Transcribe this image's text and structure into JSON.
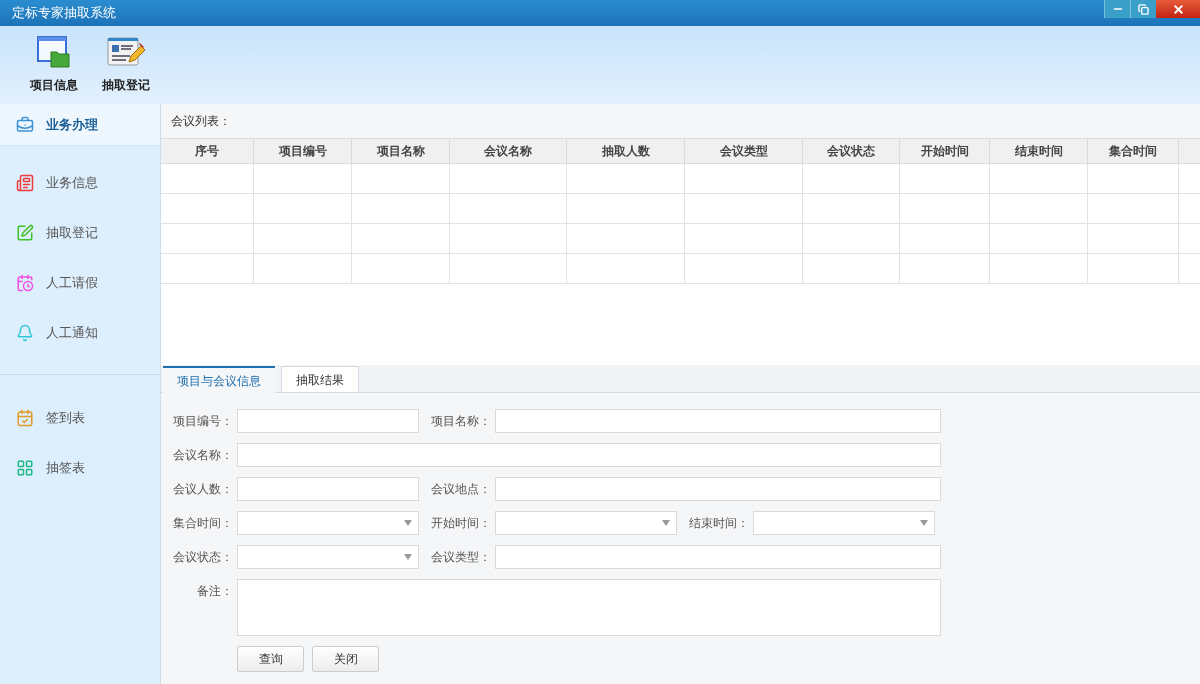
{
  "window": {
    "title": "定标专家抽取系统"
  },
  "toolbar": [
    {
      "label": "项目信息"
    },
    {
      "label": "抽取登记"
    }
  ],
  "sidebar": {
    "sections": [
      {
        "items": [
          {
            "label": "业务办理",
            "selected": true
          },
          {
            "label": "业务信息",
            "selected": false
          },
          {
            "label": "抽取登记",
            "selected": false
          },
          {
            "label": "人工请假",
            "selected": false
          },
          {
            "label": "人工通知",
            "selected": false
          }
        ]
      },
      {
        "items": [
          {
            "label": "签到表",
            "selected": false
          },
          {
            "label": "抽签表",
            "selected": false
          }
        ]
      }
    ]
  },
  "table": {
    "title": "会议列表：",
    "columns": [
      "序号",
      "项目编号",
      "项目名称",
      "会议名称",
      "抽取人数",
      "会议类型",
      "会议状态",
      "开始时间",
      "结束时间",
      "集合时间"
    ]
  },
  "tabs": [
    {
      "label": "项目与会议信息",
      "selected": true
    },
    {
      "label": "抽取结果",
      "selected": false
    }
  ],
  "form": {
    "rows": [
      [
        {
          "label": "项目编号：",
          "kind": "text"
        },
        {
          "label": "项目名称：",
          "kind": "text"
        }
      ],
      [
        {
          "label": "会议名称：",
          "kind": "text"
        }
      ],
      [
        {
          "label": "会议人数：",
          "kind": "text"
        },
        {
          "label": "会议地点：",
          "kind": "text"
        }
      ],
      [
        {
          "label": "集合时间：",
          "kind": "select"
        },
        {
          "label": "开始时间：",
          "kind": "select"
        },
        {
          "label": "结束时间：",
          "kind": "select"
        }
      ],
      [
        {
          "label": "会议状态：",
          "kind": "select"
        },
        {
          "label": "会议类型：",
          "kind": "text"
        }
      ],
      [
        {
          "label": "备注：",
          "kind": "textarea"
        }
      ]
    ],
    "buttons": [
      "查询",
      "关闭"
    ]
  }
}
